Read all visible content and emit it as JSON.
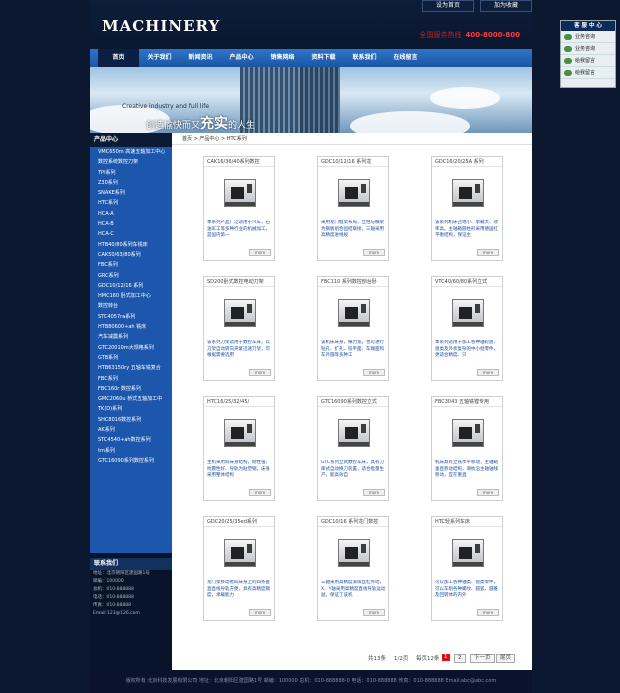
{
  "header": {
    "logo": "MACHINERY",
    "set_home": "设为首页",
    "add_fav": "加为收藏",
    "hotline_label": "全国服务热线",
    "hotline": "400-8000-800"
  },
  "nav": [
    "首页",
    "关于我们",
    "新闻资讯",
    "产品中心",
    "销售网络",
    "资料下载",
    "联系我们",
    "在线留言"
  ],
  "banner": {
    "en": "Creative industry and full life",
    "cn_pre": "创造愉快而又",
    "cn_big": "充实",
    "cn_post": "的人生"
  },
  "sidebar": {
    "title": "产品中心",
    "items": [
      "VMC650m 高速五轴加工中心",
      "数控系统数控刀架",
      "TPI系列",
      "Z30系列",
      "SNAKE系列",
      "HTC系列",
      "HCA-A",
      "HCA-B",
      "HCA-C",
      "HTB40/80系列车铣床",
      "CAK50/63/80系列",
      "FBC系列",
      "GRC系列",
      "GDC10/12/16 系列",
      "HMC160 卧式加工中心",
      "数控转台",
      "STC4057ra系列",
      "HTB80600+ah 铣床",
      "汽车减震系列",
      "GTC20010m大规格系列",
      "GTB系列",
      "HTB63150ry 五轴车铣复合",
      "FBC系列",
      "FBC160r 数控系列",
      "GMC2060u 桥式五轴加工中",
      "TK(D)系列",
      "SHC8016数控系列",
      "AK系列",
      "STC4540+ah数控系列",
      "tm系列",
      "GTC16090系列数控系列"
    ]
  },
  "contact": {
    "title": "联系我们",
    "lines": [
      "地址：北京朝阳区建国路1号",
      "邮编：100000",
      "总机：010-888888",
      "电话：010-888888",
      "传真：010-88888",
      "Email:123@126.com"
    ]
  },
  "breadcrumb": "首页 > 产品中心 > HTC系列",
  "products": [
    {
      "title": "CAK16/36/40系列数控",
      "desc": "本系列产品广泛适用于汽车，石油军工等多种行业的机械加工，是国内第一"
    },
    {
      "title": "GDC10/12/16 系列龙",
      "desc": "采用龙门框架布局，立柱与横梁为钢板组合固结联接，三轴采用高精度进线规"
    },
    {
      "title": "GDC16/20/25A 系列",
      "desc": "该系列机床占地小、承载大、效率高。主轴箱圆柱形采用德国红平衡结构，保证主"
    },
    {
      "title": "SD200卧式数控电动刀架",
      "desc": "该系列刀架适用于数控车床，以刀架自动转向夹紧迅速刀架，可根据需要选用"
    },
    {
      "title": "FBC110 系列数控刨台卧",
      "desc": "该机床床身，横力宽，也可进行钻孔、扩孔、铰平面、车端面和车外圆等多种工"
    },
    {
      "title": "VTC40/60/80系列立式",
      "desc": "本系列适用于加工各种轴轮盘、盘类及外状复杂的中小批零件，更适合精度、只"
    },
    {
      "title": "HTC16/25/32/45/",
      "desc": "主机采用斜床身结构，刚性强、抗震性好、导轨为贴塑钢，床身采用整体结构"
    },
    {
      "title": "GTC16090系列数控立式",
      "desc": "GTC系列立式数控车床，具有刀库式自动换刀装置，适合批量生产，能高效自"
    },
    {
      "title": "FBC3043 五轴铣镗专用",
      "desc": "机床具有立铣水平移动，主轴箱垂直移动结构，滑枕沿主轴轴线移动，宜在重直"
    },
    {
      "title": "GDC20/25/35ed系列",
      "desc": "龙门架移动者四床身上的四条垂直直线导轨方便，具有高精度钢度，承载能力"
    },
    {
      "title": "GDC10/16 系列龙门数控",
      "desc": "三轴采用高精度滚珠丝杠传动，X、Y轴采用高精度直线导轨运动副，保证了该机"
    },
    {
      "title": "HTC轻系列车床",
      "desc": "可以加工各种轴类、盘类零件，可以车削各种螺纹、圆弧、圆锥及回转体的内外"
    }
  ],
  "pager": {
    "total": "共13条",
    "page": "1/2页",
    "per": "每页12条",
    "current": "1",
    "pages": "2",
    "next": "下一页",
    "last": "尾页"
  },
  "footer": "版权所有 北京科技发展有限公司 地址：北京朝阳区建国路1号 邮编：100000 总机：010-888888-0 电话：010-888888 传真：010-888888 Email:abc@abc.com",
  "service": {
    "title": "客 服 中 心",
    "rows": [
      "业务咨询",
      "业务咨询",
      "给我留言",
      "给我留言"
    ]
  }
}
